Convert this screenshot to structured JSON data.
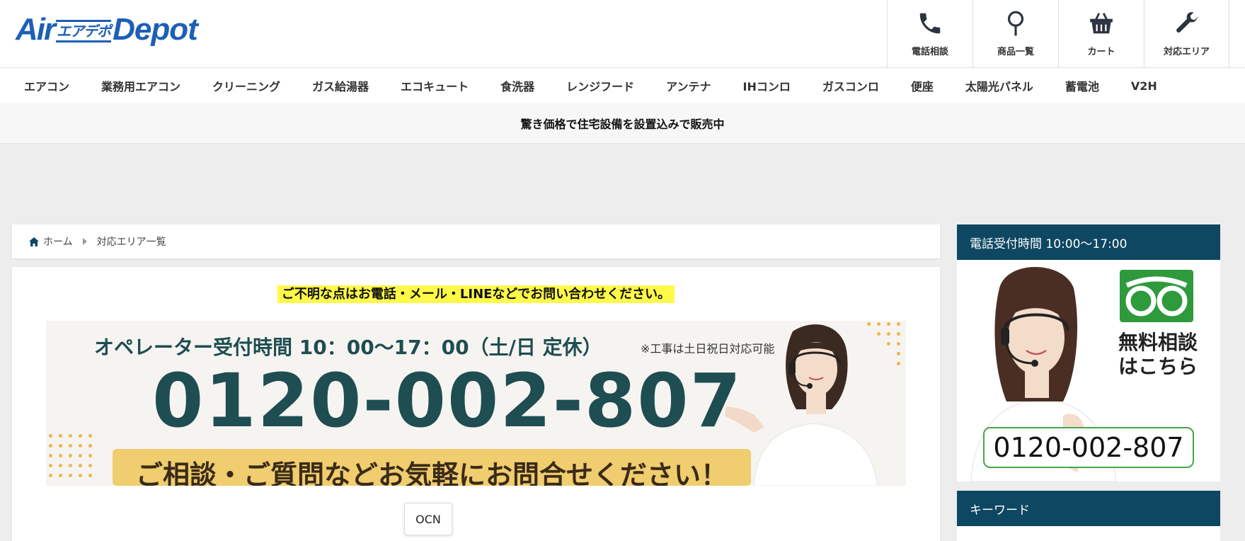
{
  "header": {
    "logo": {
      "air": "Air",
      "kana": "エアデポ",
      "depot": "Depot"
    },
    "icons": [
      {
        "name": "phone-icon",
        "label": "電話相談"
      },
      {
        "name": "search-icon",
        "label": "商品一覧"
      },
      {
        "name": "cart-icon",
        "label": "カート"
      },
      {
        "name": "wrench-icon",
        "label": "対応エリア"
      }
    ]
  },
  "nav": {
    "items": [
      "エアコン",
      "業務用エアコン",
      "クリーニング",
      "ガス給湯器",
      "エコキュート",
      "食洗器",
      "レンジフード",
      "アンテナ",
      "IHコンロ",
      "ガスコンロ",
      "便座",
      "太陽光パネル",
      "蓄電池",
      "V2H"
    ]
  },
  "notice": {
    "text": "驚き価格で住宅設備を設置込みで販売中"
  },
  "breadcrumb": {
    "home": "ホーム",
    "current": "対応エリア一覧"
  },
  "main": {
    "inquiry": "ご不明な点はお電話・メール・LINEなどでお問い合わせください。",
    "banner": {
      "hours": "オペレーター受付時間 10：00〜17：00（土/日 定休）",
      "note": "※工事は土日祝日対応可能",
      "phone": "0120-002-807",
      "tagline": "ご相談・ご質問などお気軽にお問合せください！"
    },
    "ocn_button": "OCN"
  },
  "sidebar": {
    "phone_hours_title": "電話受付時間 10:00〜17:00",
    "free_consult": [
      "無料相談",
      "はこちら"
    ],
    "phone": "0120-002-807",
    "keyword_title": "キーワード"
  },
  "colors": {
    "brand_blue": "#1d5fb7",
    "sidebar_head": "#0e4761",
    "banner_teal": "#1e4d52",
    "banner_strip": "#f0cd6e",
    "highlight": "#fff94a",
    "free_green": "#2e9a3c"
  }
}
